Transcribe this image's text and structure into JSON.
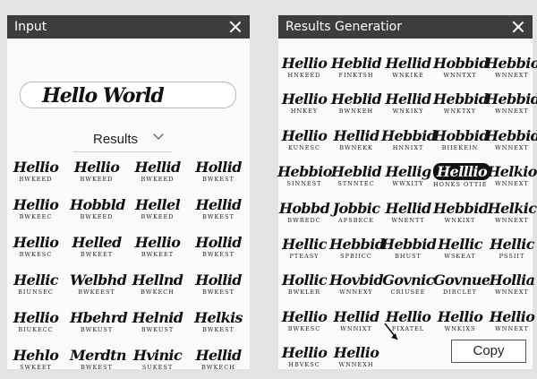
{
  "input_panel": {
    "title": "Input",
    "input_value": "Hello World",
    "results_label": "Results"
  },
  "results_panel": {
    "title": "Results Generatior",
    "copy_label": "Copy"
  },
  "left_items": [
    {
      "script": "Hellio",
      "caption": "BWKEED"
    },
    {
      "script": "Hellio",
      "caption": "BWKEED"
    },
    {
      "script": "Hellid",
      "caption": "BWKEED"
    },
    {
      "script": "Hollid",
      "caption": "BWKEST"
    },
    {
      "script": "Hellio",
      "caption": "BWKEEC"
    },
    {
      "script": "Hobbld",
      "caption": "BWKEED"
    },
    {
      "script": "Hellel",
      "caption": "BWKEED"
    },
    {
      "script": "Hellid",
      "caption": "BWKEST"
    },
    {
      "script": "Hellio",
      "caption": "BWKESC"
    },
    {
      "script": "Helled",
      "caption": "BWKEET"
    },
    {
      "script": "Hellio",
      "caption": "BWKEET"
    },
    {
      "script": "Hollid",
      "caption": "BWKEST"
    },
    {
      "script": "Hellic",
      "caption": "BIUNSEC"
    },
    {
      "script": "Welbhd",
      "caption": "BWKEEST"
    },
    {
      "script": "Hellnd",
      "caption": "BWKECH"
    },
    {
      "script": "Hollid",
      "caption": "BWKEST"
    },
    {
      "script": "Hellio",
      "caption": "BIUKECC"
    },
    {
      "script": "Hbehrd",
      "caption": "BWKUST"
    },
    {
      "script": "Helnid",
      "caption": "BWKUST"
    },
    {
      "script": "Helkis",
      "caption": "BWKEST"
    },
    {
      "script": "Hehlo",
      "caption": "SWKEET"
    },
    {
      "script": "Merdtn",
      "caption": "BWKEST"
    },
    {
      "script": "Hvinic",
      "caption": "SUKEST"
    },
    {
      "script": "Hellid",
      "caption": "BWKECH"
    }
  ],
  "right_items": [
    {
      "script": "Hellio",
      "caption": "HNKEED"
    },
    {
      "script": "Heblid",
      "caption": "FINKTSH"
    },
    {
      "script": "Hellid",
      "caption": "WNKIKE"
    },
    {
      "script": "Hobbid",
      "caption": "WNNTXT"
    },
    {
      "script": "Hebbio",
      "caption": "WNNEXT"
    },
    {
      "script": "Hellio",
      "caption": "HNKEY"
    },
    {
      "script": "Heblid",
      "caption": "BWNKEH"
    },
    {
      "script": "Hellid",
      "caption": "WNKIKY"
    },
    {
      "script": "Hebbid",
      "caption": "WNKTXY"
    },
    {
      "script": "Hebbid",
      "caption": "WNNEXT"
    },
    {
      "script": "Hellio",
      "caption": "KUNESC"
    },
    {
      "script": "Hellid",
      "caption": "BWNEKK"
    },
    {
      "script": "Hebbid",
      "caption": "HNNIXT"
    },
    {
      "script": "Hobbid",
      "caption": "BIIEKEIN"
    },
    {
      "script": "Hebbid",
      "caption": "WNNEXT"
    },
    {
      "script": "Hebbio",
      "caption": "SINNEST"
    },
    {
      "script": "Heblid",
      "caption": "STNNTEC"
    },
    {
      "script": "Hellig",
      "caption": "WWXITY"
    },
    {
      "script": "Helllio",
      "caption": "HONKS OTTIE"
    },
    {
      "script": "Helkio",
      "caption": "WNNEXT"
    },
    {
      "script": "Hobbd",
      "caption": "BWREDC"
    },
    {
      "script": "Jobbic",
      "caption": "AFSBECE"
    },
    {
      "script": "Hellid",
      "caption": "WNENTT"
    },
    {
      "script": "Hebbid",
      "caption": "WNKIXT"
    },
    {
      "script": "Helkic",
      "caption": "WNNEXT"
    },
    {
      "script": "Hellic",
      "caption": "PTEASY"
    },
    {
      "script": "Hebbid",
      "caption": "SPBIICC"
    },
    {
      "script": "Hebbid",
      "caption": "BHUST"
    },
    {
      "script": "Hellic",
      "caption": "WSKEAT"
    },
    {
      "script": "Hellic",
      "caption": "PSSIIT"
    },
    {
      "script": "Hollic",
      "caption": "BWKLER"
    },
    {
      "script": "Hovbid",
      "caption": "WNNEXY"
    },
    {
      "script": "Govnic",
      "caption": "CRIUSEE"
    },
    {
      "script": "Govnue",
      "caption": "DIRCLET"
    },
    {
      "script": "Hollia",
      "caption": "WNNEXT"
    },
    {
      "script": "Hellio",
      "caption": "BWKESC"
    },
    {
      "script": "Hellid",
      "caption": "WNNIXT"
    },
    {
      "script": "Hellio",
      "caption": "FIXATEL"
    },
    {
      "script": "Hellio",
      "caption": "WNKIXS"
    },
    {
      "script": "Hellio",
      "caption": "WNNEXT"
    },
    {
      "script": "Hellio",
      "caption": "HBVKSC"
    },
    {
      "script": "Hellio",
      "caption": "WNNEXH"
    }
  ]
}
